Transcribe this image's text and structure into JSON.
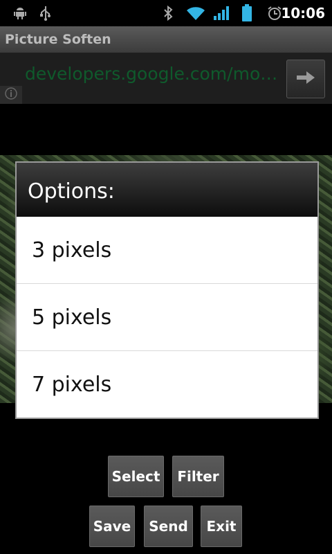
{
  "status_bar": {
    "time": "10:06",
    "icons": [
      "android-debug-icon",
      "usb-icon",
      "bluetooth-icon",
      "wifi-icon",
      "signal-icon",
      "battery-icon",
      "alarm-icon"
    ]
  },
  "app": {
    "title": "Picture Soften"
  },
  "url_bar": {
    "url": "developers.google.com/mob..."
  },
  "dialog": {
    "title": "Options:",
    "options": [
      "3 pixels",
      "5 pixels",
      "7 pixels"
    ]
  },
  "buttons": {
    "select": "Select",
    "filter": "Filter",
    "save": "Save",
    "send": "Send",
    "exit": "Exit"
  },
  "colors": {
    "url_text": "#0f5a2c",
    "battery": "#33b5e5",
    "wifi": "#33b5e5"
  }
}
